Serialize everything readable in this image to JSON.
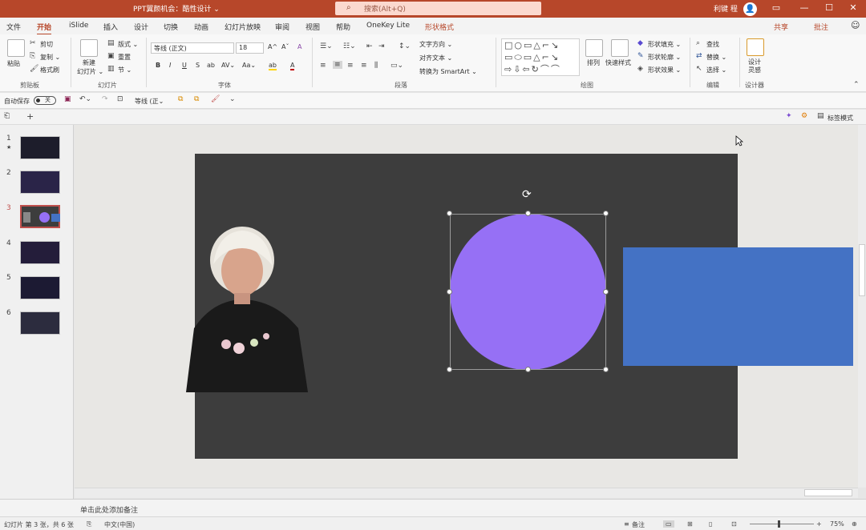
{
  "titlebar": {
    "document_title": "PPT翼颜机会：酷性设计 ⌄",
    "search_placeholder": "搜索(Alt+Q)",
    "user_name": "利键 程",
    "avatar_glyph": "👤",
    "restore_icon": "▭",
    "minimize_icon": "—",
    "maximize_icon": "☐",
    "close_icon": "✕"
  },
  "menu": {
    "tabs": [
      "文件",
      "开始",
      "iSlide",
      "插入",
      "设计",
      "切换",
      "动画",
      "幻灯片放映",
      "审阅",
      "视图",
      "帮助",
      "OneKey Lite",
      "形状格式"
    ],
    "active": "开始",
    "share": "共享",
    "comment": "批注",
    "smile_icon": "☺"
  },
  "ribbon": {
    "clipboard": {
      "paste": "粘贴",
      "cut": "剪切",
      "copy": "复制 ⌄",
      "format_painter": "格式刷",
      "label": "剪贴板"
    },
    "slides": {
      "new_slide": "新建",
      "new_slide2": "幻灯片 ⌄",
      "layout": "版式 ⌄",
      "reset": "重置",
      "section": "节 ⌄",
      "label": "幻灯片"
    },
    "font": {
      "name": "等线 (正文)",
      "size": "18",
      "bold": "B",
      "italic": "I",
      "underline": "U",
      "strike": "S",
      "shadow": "ab",
      "spacing": "AV⌄",
      "case": "Aa⌄",
      "grow": "A^",
      "shrink": "Aˇ",
      "clear": "A",
      "highlight": "ab",
      "color": "A",
      "label": "字体"
    },
    "paragraph": {
      "text_direction": "文字方向 ⌄",
      "align_text": "对齐文本 ⌄",
      "smartart": "转换为 SmartArt ⌄",
      "label": "段落"
    },
    "drawing": {
      "arrange": "排列",
      "quick_styles": "快速样式",
      "fill": "形状填充 ⌄",
      "outline": "形状轮廓 ⌄",
      "effects": "形状效果 ⌄",
      "label": "绘图"
    },
    "editing": {
      "find": "查找",
      "replace": "替换 ⌄",
      "select": "选择 ⌄",
      "label": "编辑"
    },
    "designer": {
      "design_ideas": "设计",
      "design_ideas2": "灵感",
      "label": "设计器"
    }
  },
  "qat": {
    "autosave": "自动保存",
    "toggle": "关",
    "font": "等线 (正⌄"
  },
  "panelbar": {
    "view_label": "标签模式"
  },
  "slides": {
    "numbers": [
      "1",
      "2",
      "3",
      "4",
      "5",
      "6"
    ],
    "star": "★",
    "selected": "3"
  },
  "notes": {
    "placeholder": "单击此处添加备注"
  },
  "status": {
    "slide_info": "幻灯片 第 3 张，共 6 张",
    "language": "中文(中国)",
    "notes_btn": "备注",
    "zoom": "75%",
    "minus": "−",
    "plus": "+"
  },
  "colors": {
    "accent": "#b7472a",
    "circle": "#9670f5",
    "rect": "#4472c4",
    "slide_bg": "#3d3d3d"
  }
}
